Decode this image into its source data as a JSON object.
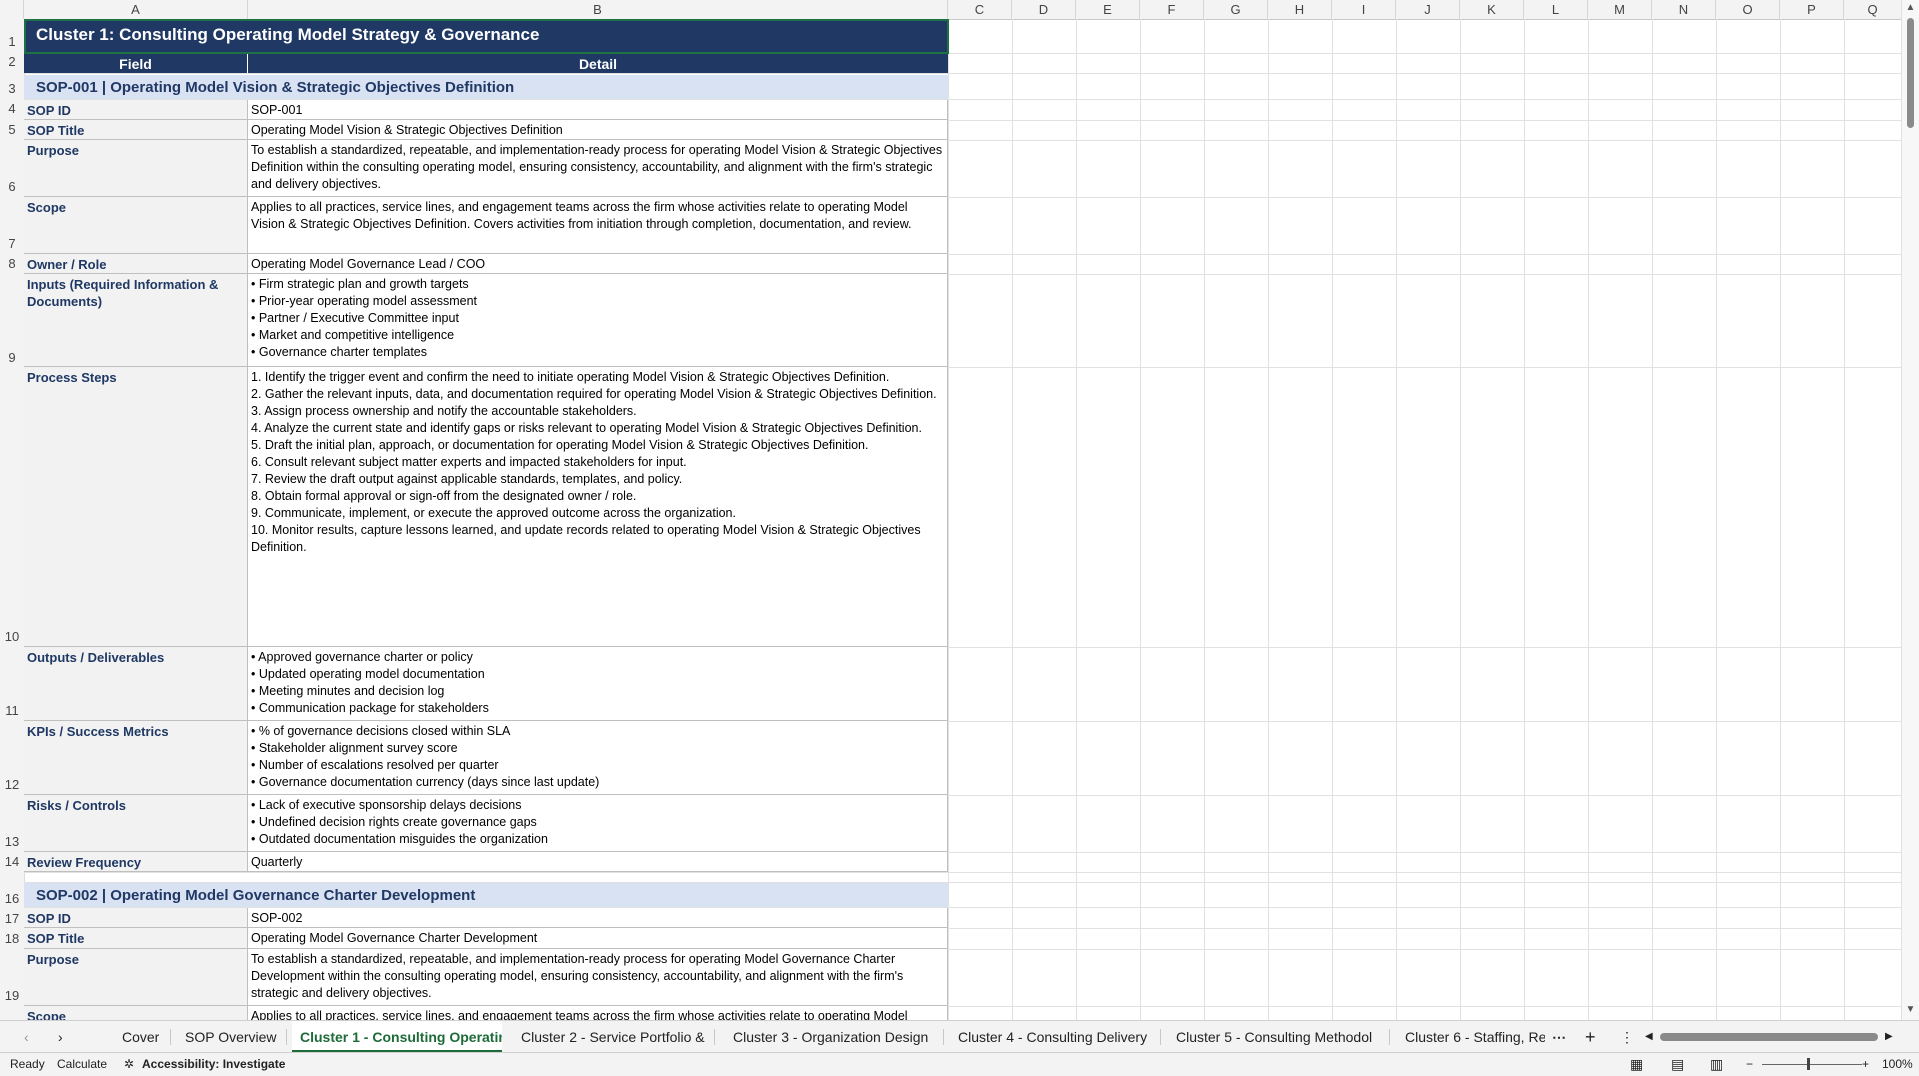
{
  "columns": [
    "A",
    "B",
    "C",
    "D",
    "E",
    "F",
    "G",
    "H",
    "I",
    "J",
    "K",
    "L",
    "M",
    "N",
    "O",
    "P",
    "Q"
  ],
  "rows": [
    "1",
    "2",
    "3",
    "4",
    "5",
    "6",
    "7",
    "8",
    "9",
    "10",
    "11",
    "12",
    "13",
    "14",
    "16",
    "17",
    "18",
    "19"
  ],
  "sheet": {
    "title": "Cluster 1: Consulting Operating Model Strategy & Governance",
    "header_field": "Field",
    "header_detail": "Detail",
    "sop1": {
      "section": "SOP-001  |  Operating Model Vision & Strategic Objectives Definition",
      "fields": [
        {
          "label": "SOP ID",
          "value": "SOP-001"
        },
        {
          "label": "SOP Title",
          "value": "Operating Model Vision & Strategic Objectives Definition"
        },
        {
          "label": "Purpose",
          "value": "To establish a standardized, repeatable, and implementation-ready process for operating Model Vision & Strategic Objectives Definition within the consulting operating model, ensuring consistency, accountability, and alignment with the firm's strategic and delivery objectives."
        },
        {
          "label": "Scope",
          "value": "Applies to all practices, service lines, and engagement teams across the firm whose activities relate to operating Model Vision & Strategic Objectives Definition. Covers activities from initiation through completion, documentation, and review."
        },
        {
          "label": "Owner / Role",
          "value": "Operating Model Governance Lead / COO"
        },
        {
          "label": "Inputs (Required Information & Documents)",
          "value": "• Firm strategic plan and growth targets\n• Prior-year operating model assessment\n• Partner / Executive Committee input\n• Market and competitive intelligence\n• Governance charter templates"
        },
        {
          "label": "Process Steps",
          "value": "1. Identify the trigger event and confirm the need to initiate operating Model Vision & Strategic Objectives Definition.\n2. Gather the relevant inputs, data, and documentation required for operating Model Vision & Strategic Objectives Definition.\n3. Assign process ownership and notify the accountable stakeholders.\n4. Analyze the current state and identify gaps or risks relevant to operating Model Vision & Strategic Objectives Definition.\n5. Draft the initial plan, approach, or documentation for operating Model Vision & Strategic Objectives Definition.\n6. Consult relevant subject matter experts and impacted stakeholders for input.\n7. Review the draft output against applicable standards, templates, and policy.\n8. Obtain formal approval or sign-off from the designated owner / role.\n9. Communicate, implement, or execute the approved outcome across the organization.\n10. Monitor results, capture lessons learned, and update records related to operating Model Vision & Strategic Objectives Definition."
        },
        {
          "label": "Outputs / Deliverables",
          "value": "• Approved governance charter or policy\n• Updated operating model documentation\n• Meeting minutes and decision log\n• Communication package for stakeholders"
        },
        {
          "label": "KPIs / Success Metrics",
          "value": "• % of governance decisions closed within SLA\n• Stakeholder alignment survey score\n• Number of escalations resolved per quarter\n• Governance documentation currency (days since last update)"
        },
        {
          "label": "Risks / Controls",
          "value": "• Lack of executive sponsorship delays decisions\n• Undefined decision rights create governance gaps\n• Outdated documentation misguides the organization"
        },
        {
          "label": "Review Frequency",
          "value": "Quarterly"
        }
      ]
    },
    "sop2": {
      "section": "SOP-002  |  Operating Model Governance Charter Development",
      "fields": [
        {
          "label": "SOP ID",
          "value": "SOP-002"
        },
        {
          "label": "SOP Title",
          "value": "Operating Model Governance Charter Development"
        },
        {
          "label": "Purpose",
          "value": "To establish a standardized, repeatable, and implementation-ready process for operating Model Governance Charter Development within the consulting operating model, ensuring consistency, accountability, and alignment with the firm's strategic and delivery objectives."
        },
        {
          "label": "Scope",
          "value": "Applies to all practices, service lines, and engagement teams across the firm whose activities relate to operating Model"
        }
      ]
    }
  },
  "tabs": [
    "Cover",
    "SOP Overview",
    "Cluster 1 - Consulting Operatin",
    "Cluster 2 - Service Portfolio &",
    "Cluster 3 - Organization Design",
    "Cluster 4 - Consulting Delivery",
    "Cluster 5 - Consulting Methodol",
    "Cluster 6 - Staffing, Re"
  ],
  "active_tab_index": 2,
  "status": {
    "ready": "Ready",
    "calculate": "Calculate",
    "accessibility": "Accessibility: Investigate",
    "zoom": "100%"
  },
  "colors": {
    "navy": "#1f3864",
    "section": "#d9e2f3",
    "excel_green": "#1e6b3a"
  }
}
